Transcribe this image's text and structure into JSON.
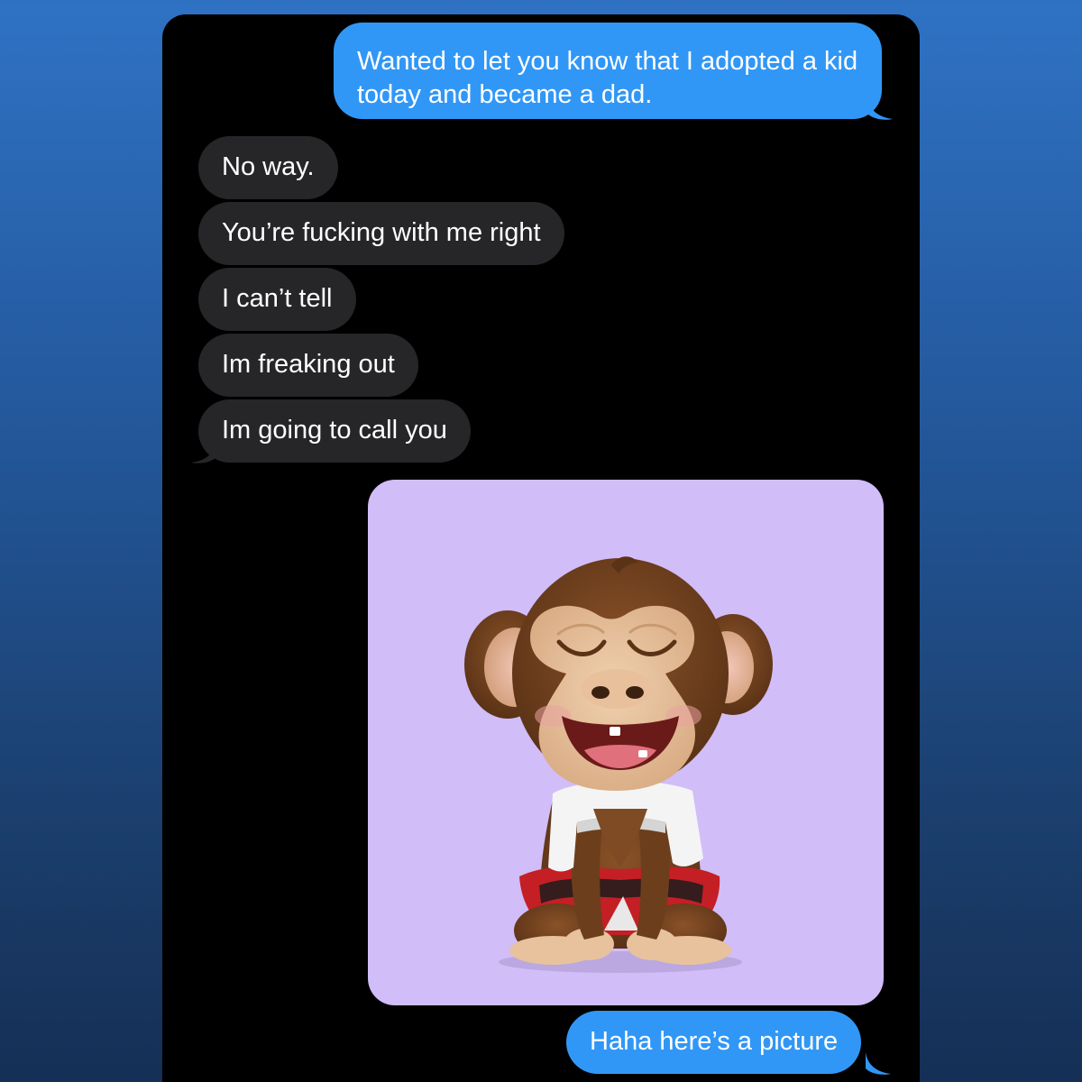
{
  "conversation": {
    "messages": [
      {
        "direction": "outgoing",
        "text": "Wanted to let you know that I adopted a kid today and became a dad."
      },
      {
        "direction": "incoming",
        "text": "No way."
      },
      {
        "direction": "incoming",
        "text": "You’re fucking with me right"
      },
      {
        "direction": "incoming",
        "text": "I can’t tell"
      },
      {
        "direction": "incoming",
        "text": "Im freaking out"
      },
      {
        "direction": "incoming",
        "text": "Im going to call you"
      },
      {
        "direction": "outgoing",
        "type": "image",
        "image": "cartoon-monkey-in-towel"
      },
      {
        "direction": "outgoing",
        "text": "Haha here’s a picture"
      }
    ]
  },
  "colors": {
    "outgoing_bubble": "#3197f6",
    "incoming_bubble": "#262629",
    "chat_background": "#000000",
    "photo_background": "#d1bdf8"
  }
}
